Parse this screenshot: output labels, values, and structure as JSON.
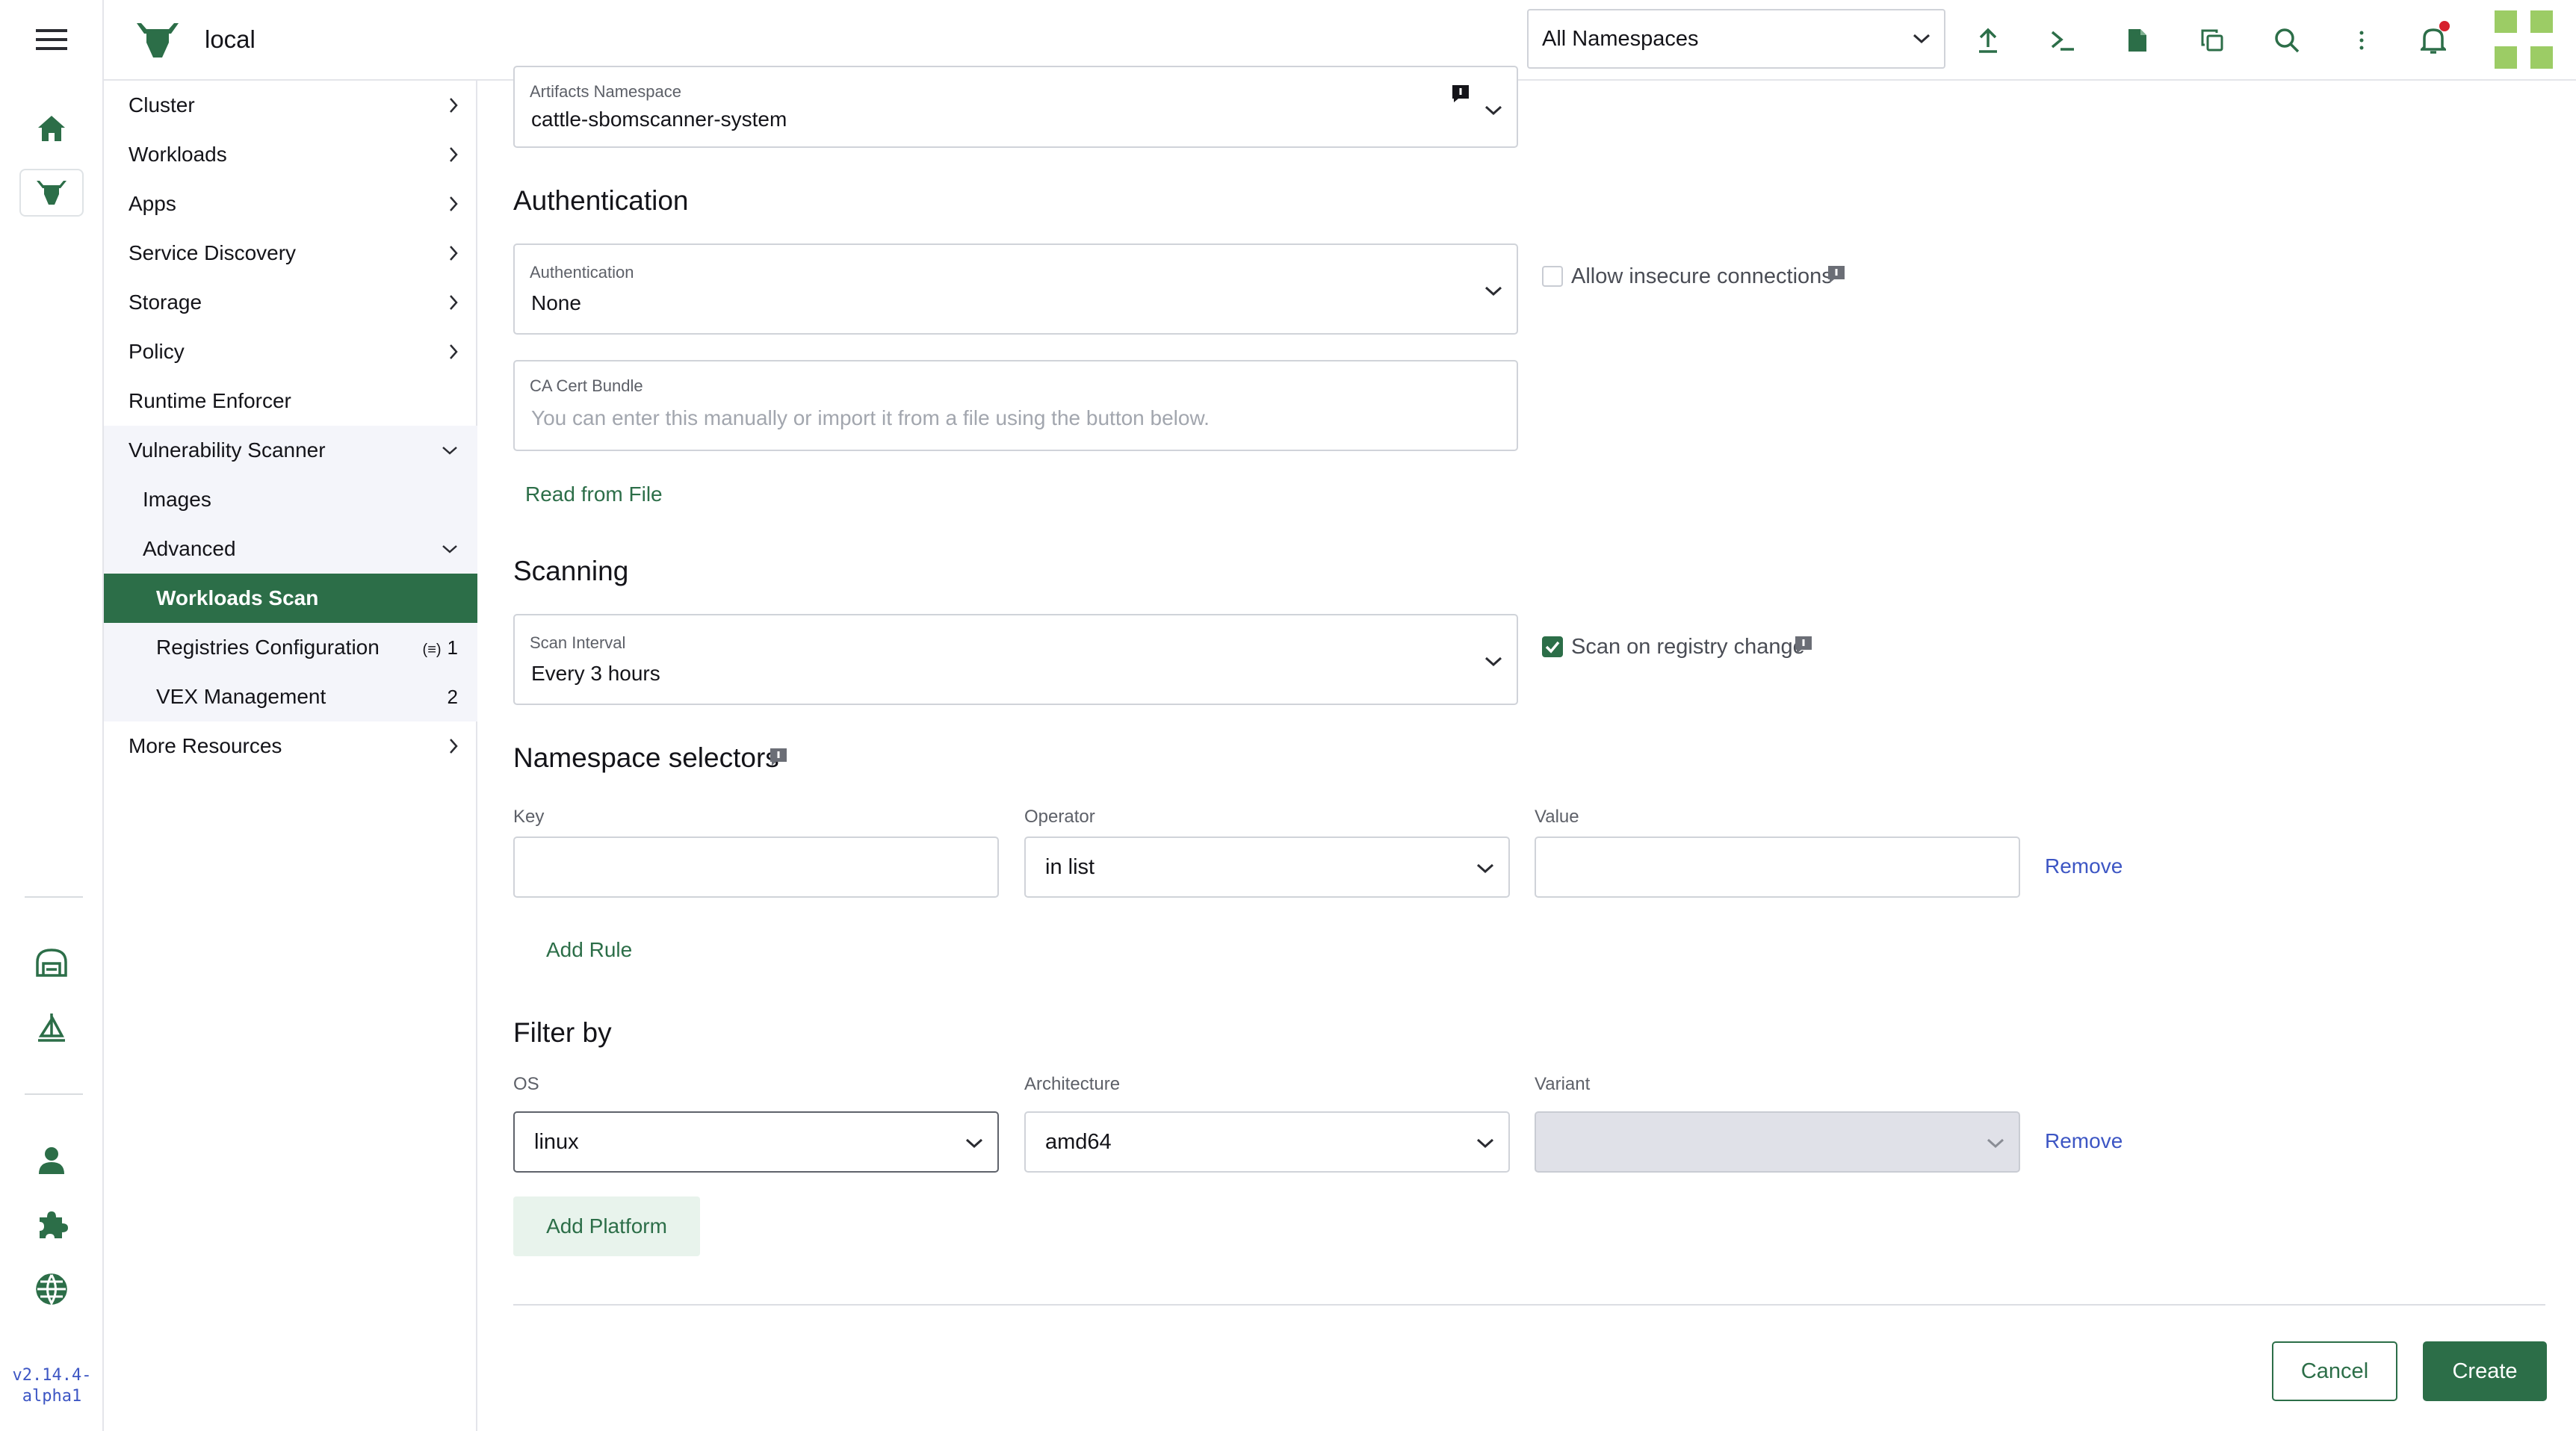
{
  "header": {
    "cluster_name": "local",
    "namespace_select": "All Namespaces"
  },
  "rail": {
    "version": "v2.14.4-alpha1"
  },
  "sidenav": {
    "items": [
      {
        "label": "Cluster"
      },
      {
        "label": "Workloads"
      },
      {
        "label": "Apps"
      },
      {
        "label": "Service Discovery"
      },
      {
        "label": "Storage"
      },
      {
        "label": "Policy"
      },
      {
        "label": "Runtime Enforcer"
      },
      {
        "label": "Vulnerability Scanner"
      },
      {
        "label": "Images"
      },
      {
        "label": "Advanced"
      },
      {
        "label": "Workloads Scan"
      },
      {
        "label": "Registries Configuration",
        "count": "1"
      },
      {
        "label": "VEX Management",
        "count": "2"
      },
      {
        "label": "More Resources"
      }
    ]
  },
  "form": {
    "artifacts_namespace": {
      "label": "Artifacts Namespace",
      "value": "cattle-sbomscanner-system"
    },
    "authentication_heading": "Authentication",
    "authentication": {
      "label": "Authentication",
      "value": "None"
    },
    "allow_insecure_label": "Allow insecure connections",
    "ca_cert": {
      "label": "CA Cert Bundle",
      "placeholder": "You can enter this manually or import it from a file using the button below."
    },
    "read_from_file": "Read from File",
    "scanning_heading": "Scanning",
    "scan_interval": {
      "label": "Scan Interval",
      "value": "Every 3 hours"
    },
    "scan_on_change_label": "Scan on registry change",
    "namespace_selectors_heading": "Namespace selectors",
    "key_label": "Key",
    "operator_label": "Operator",
    "operator_value": "in list",
    "value_label": "Value",
    "remove": "Remove",
    "add_rule": "Add Rule",
    "filter_heading": "Filter by",
    "os_label": "OS",
    "os_value": "linux",
    "arch_label": "Architecture",
    "arch_value": "amd64",
    "variant_label": "Variant",
    "add_platform": "Add Platform",
    "cancel": "Cancel",
    "create": "Create"
  },
  "colors": {
    "accent": "#2c6e48",
    "link_blue": "#3d56c4",
    "notification": "#d6202d"
  }
}
